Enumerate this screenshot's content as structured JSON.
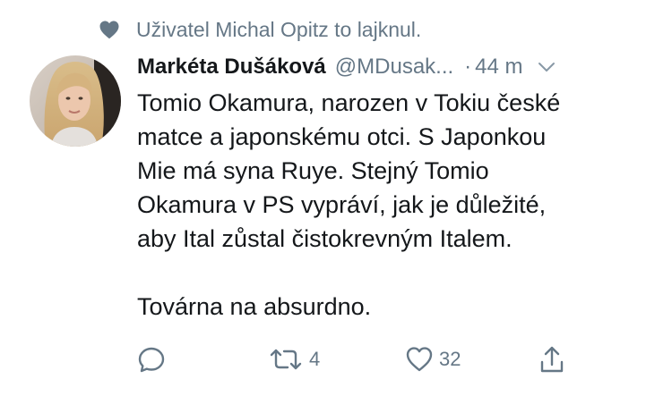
{
  "social_context": {
    "icon": "heart-icon",
    "text": "Uživatel Michal Opitz to lajknul."
  },
  "tweet": {
    "author": {
      "name": "Markéta Dušáková",
      "handle": "@MDusak...",
      "separator": "·",
      "time": "44 m"
    },
    "body_lines": [
      "Tomio Okamura, narozen v Tokiu české",
      "matce a japonskému otci. S Japonkou",
      "Mie má syna Ruye. Stejný Tomio",
      "Okamura v PS vypráví, jak je důležité,",
      "aby Ital zůstal čistokrevným Italem."
    ],
    "body_last_line": "Továrna na absurdno.",
    "actions": {
      "reply": {
        "icon": "reply-icon"
      },
      "retweet": {
        "icon": "retweet-icon",
        "count": "4"
      },
      "like": {
        "icon": "like-icon",
        "count": "32"
      },
      "share": {
        "icon": "share-icon"
      }
    }
  },
  "colors": {
    "text": "#14171a",
    "secondary": "#657786",
    "background": "#ffffff"
  }
}
